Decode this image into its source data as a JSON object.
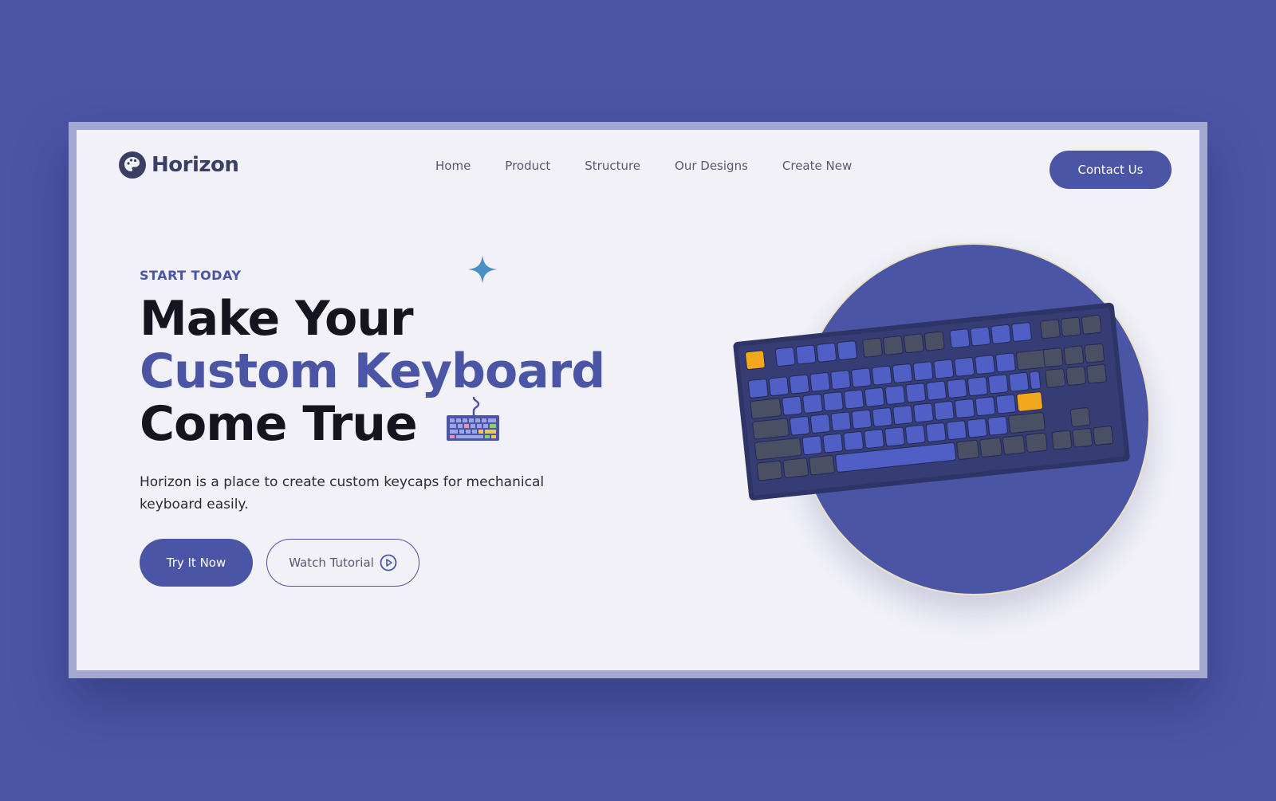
{
  "brand": {
    "name": "Horizon",
    "logo_icon": "palette-icon"
  },
  "nav": {
    "items": [
      "Home",
      "Product",
      "Structure",
      "Our Designs",
      "Create New"
    ],
    "contact_label": "Contact Us"
  },
  "hero": {
    "eyebrow": "START TODAY",
    "headline_line1": "Make Your",
    "headline_line2": "Custom Keyboard",
    "headline_line3": "Come True",
    "description": "Horizon is a place to create custom keycaps for mechanical keyboard easily.",
    "primary_cta": "Try It Now",
    "secondary_cta": "Watch Tutorial",
    "secondary_cta_icon": "play-circle-icon",
    "decor_icons": [
      "sparkle-icon",
      "keyboard-icon"
    ]
  },
  "colors": {
    "background": "#4b55a5",
    "page": "#f1f1f7",
    "accent": "#4b55a5",
    "heading": "#14151f",
    "keycap_highlight": "#f2a81d"
  }
}
